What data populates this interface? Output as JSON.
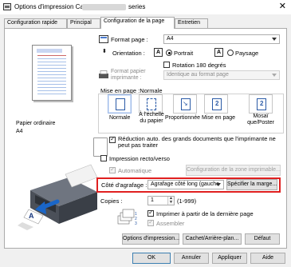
{
  "window": {
    "title": "Options d'impression Canon",
    "title_suffix": "series",
    "close_glyph": "✕"
  },
  "tabs": [
    {
      "label": "Configuration rapide"
    },
    {
      "label": "Principal"
    },
    {
      "label": "Configuration de la page"
    },
    {
      "label": "Entretien"
    }
  ],
  "preview": {
    "media_type": "Papier ordinaire",
    "media_size": "A4"
  },
  "format_page": {
    "label": "Format page :",
    "value": "A4"
  },
  "orientation": {
    "label": "Orientation :",
    "portrait_label": "Portrait",
    "paysage_label": "Paysage",
    "rotation_label": "Rotation 180 degrés",
    "selected": "Portrait"
  },
  "format_papier": {
    "label_line1": "Format papier",
    "label_line2": "imprimante :",
    "value": "Identique au format page"
  },
  "mise_en_page": {
    "label": "Mise en page :Normale",
    "options": [
      {
        "label": "Normale"
      },
      {
        "label": "À l'échelle du papier"
      },
      {
        "label": "Proportionnée"
      },
      {
        "label": "Mise en page"
      },
      {
        "label": "Mosaï que/Poster"
      }
    ],
    "badge_2": "2",
    "selected": "Normale"
  },
  "reduction_auto": {
    "label": "Réduction auto. des grands documents que l'imprimante ne peut pas traiter",
    "checked": true
  },
  "recto_verso": {
    "label": "Impression recto/verso",
    "checked": false,
    "automatique_label": "Automatique",
    "automatique_checked": true,
    "config_zone_button": "Configuration de la zone imprimable..."
  },
  "agrafage": {
    "label": "Côté d'agrafage :",
    "value": "Agrafage côté long (gauche",
    "marge_button": "Spécifier la marge..."
  },
  "copies": {
    "label": "Copies :",
    "value": "1",
    "range": "(1-999)",
    "derniere_page_label": "Imprimer à partir de la dernière page",
    "derniere_page_checked": true,
    "assembler_label": "Assembler",
    "assembler_checked": true
  },
  "footer_buttons": {
    "options_impression": "Options d'impression...",
    "cachet": "Cachet/Arrière-plan...",
    "defaut": "Défaut"
  },
  "dialog_buttons": {
    "ok": "OK",
    "annuler": "Annuler",
    "appliquer": "Appliquer",
    "aide": "Aide"
  },
  "colors": {
    "highlight": "#e02020",
    "accent": "#2a5aa6"
  }
}
